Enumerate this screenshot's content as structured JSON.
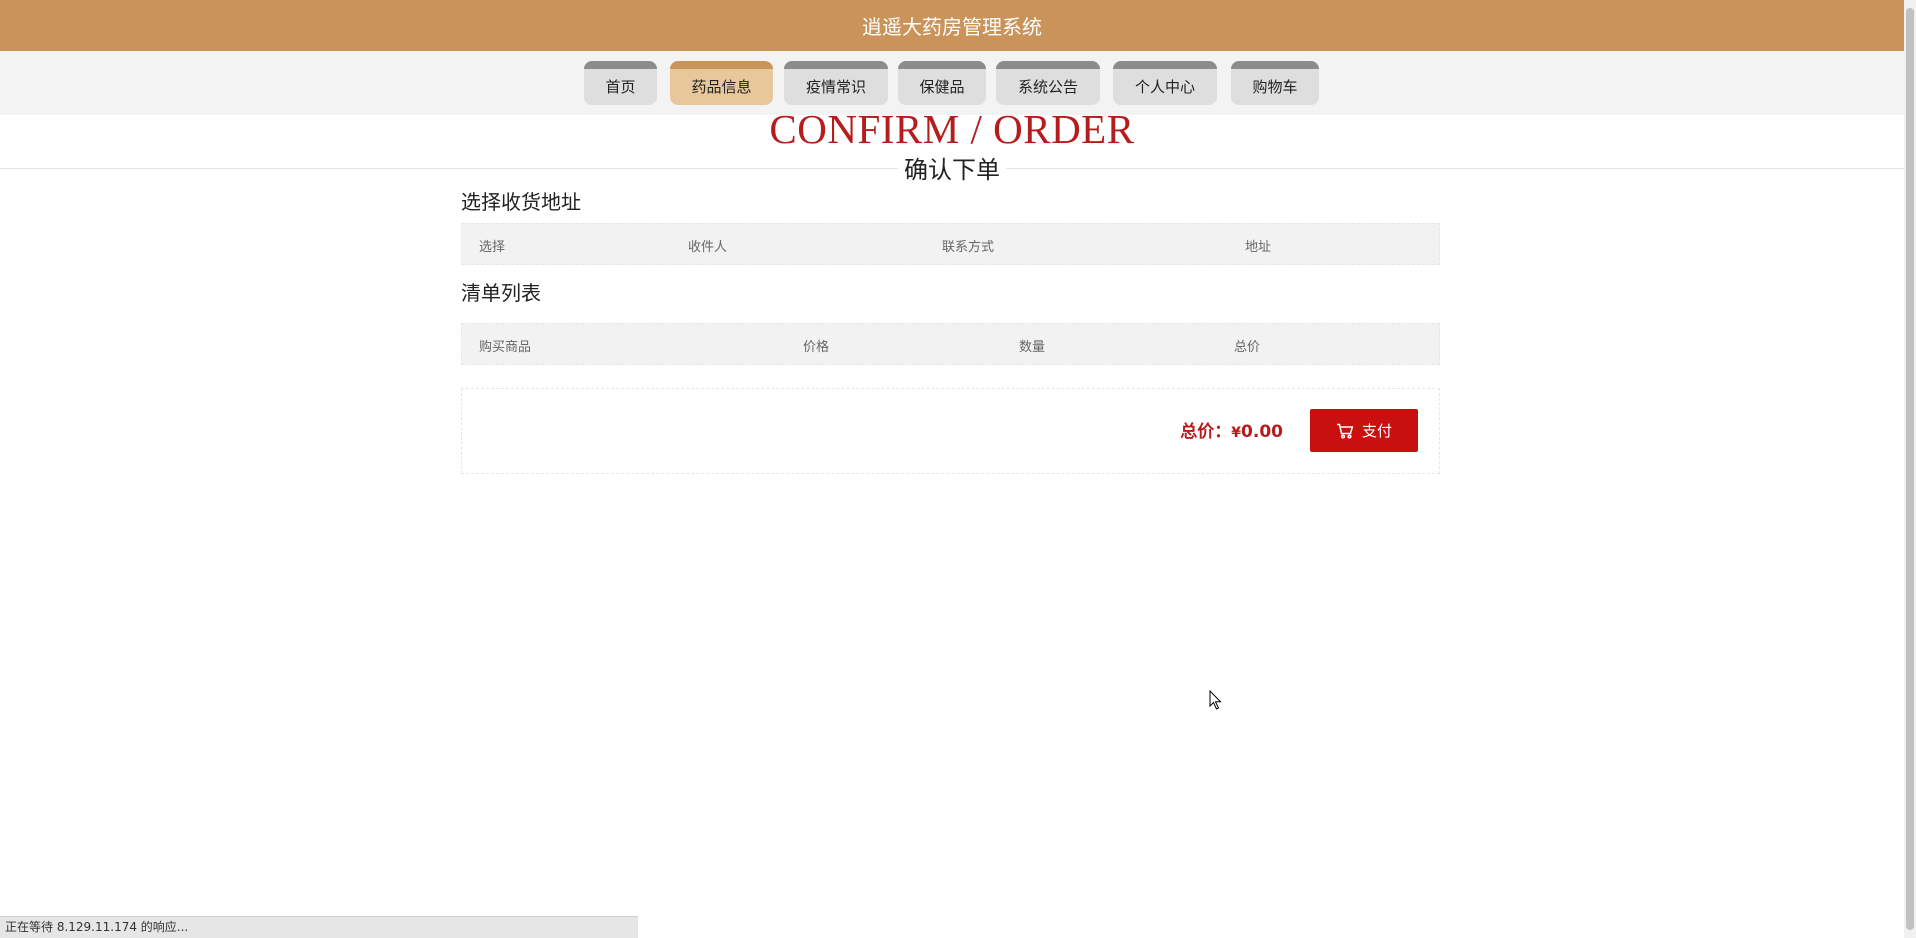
{
  "app": {
    "title": "逍遥大药房管理系统"
  },
  "nav": {
    "items": [
      {
        "label": "首页"
      },
      {
        "label": "药品信息",
        "active": true
      },
      {
        "label": "疫情常识"
      },
      {
        "label": "保健品"
      },
      {
        "label": "系统公告"
      },
      {
        "label": "个人中心"
      },
      {
        "label": "购物车"
      }
    ]
  },
  "page": {
    "title_en": "CONFIRM / ORDER",
    "title_cn": "确认下单"
  },
  "address_section": {
    "title": "选择收货地址",
    "columns": [
      "选择",
      "收件人",
      "联系方式",
      "地址"
    ],
    "rows": []
  },
  "order_section": {
    "title": "清单列表",
    "columns": [
      "购买商品",
      "价格",
      "数量",
      "总价"
    ],
    "rows": []
  },
  "summary": {
    "total_label": "总价：",
    "currency": "¥",
    "total_value": "0.00",
    "pay_label": "支付"
  },
  "status_bar": {
    "text": "正在等待 8.129.11.174 的响应..."
  },
  "colors": {
    "header_bg": "#c9935a",
    "active_tab": "#e8c89a",
    "accent_red": "#c8110f"
  },
  "icons": {
    "pay_button": "cart-icon"
  }
}
